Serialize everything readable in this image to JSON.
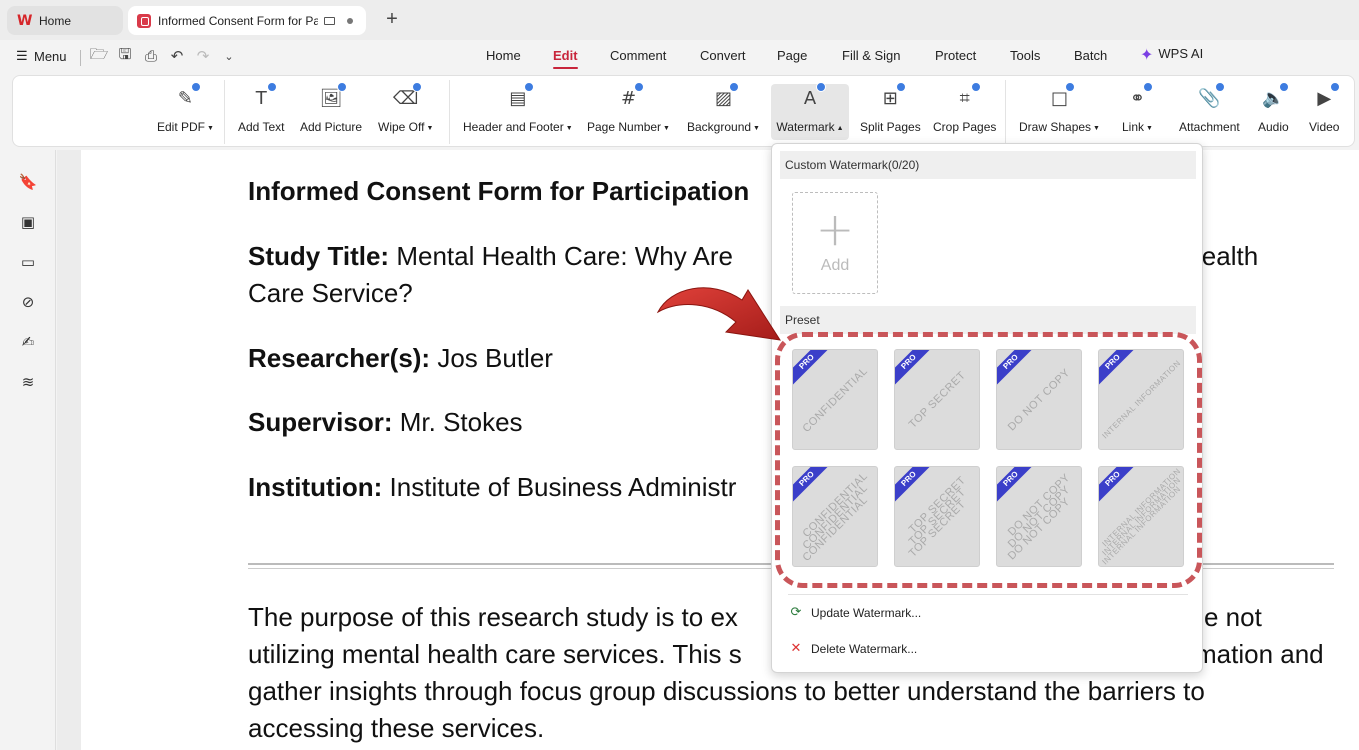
{
  "tabs": {
    "home": "Home",
    "document": "Informed Consent Form for Pa"
  },
  "menu": {
    "label": "Menu",
    "nav": [
      "Home",
      "Edit",
      "Comment",
      "Convert",
      "Page",
      "Fill & Sign",
      "Protect",
      "Tools",
      "Batch",
      "WPS AI"
    ],
    "active": "Edit"
  },
  "ribbon": {
    "edit_pdf": "Edit PDF",
    "add_text": "Add Text",
    "add_picture": "Add Picture",
    "wipe_off": "Wipe Off",
    "header_footer": "Header and Footer",
    "page_number": "Page Number",
    "background": "Background",
    "watermark": "Watermark",
    "split_pages": "Split Pages",
    "crop_pages": "Crop Pages",
    "draw_shapes": "Draw Shapes",
    "link": "Link",
    "attachment": "Attachment",
    "audio": "Audio",
    "video": "Video"
  },
  "document": {
    "title": "Informed Consent Form for Participation",
    "study_label": "Study Title:",
    "study_value_1": "Mental Health Care: Why Are",
    "study_value_tail": "Health",
    "study_value_2": "Care Service?",
    "researcher_label": "Researcher(s):",
    "researcher_value": "Jos Butler",
    "supervisor_label": "Supervisor:",
    "supervisor_value": "Mr. Stokes",
    "institution_label": "Institution:",
    "institution_value": "Institute of Business Administr",
    "para_line1_a": "The purpose of this research study is to ex",
    "para_line1_b": "e not",
    "para_line2_a": "utilizing mental health care services. This s",
    "para_line2_b": "mation and",
    "para_line3": "gather insights through focus group discussions to better understand the barriers to",
    "para_line4": "accessing these services."
  },
  "watermark_menu": {
    "custom_header": "Custom Watermark(0/20)",
    "add_label": "Add",
    "preset_header": "Preset",
    "pro_badge": "PRO",
    "presets": [
      {
        "text": "CONFIDENTIAL"
      },
      {
        "text": "TOP SECRET"
      },
      {
        "text": "DO NOT COPY"
      },
      {
        "text": "INTERNAL INFORMATION"
      },
      {
        "text": "CONFIDENTIAL"
      },
      {
        "text": "TOP SECRET"
      },
      {
        "text": "DO NOT COPY"
      },
      {
        "text": "INTERNAL INFORMATION"
      }
    ],
    "update": "Update Watermark...",
    "delete": "Delete Watermark..."
  },
  "colors": {
    "accent": "#c8253b",
    "annotation": "#c9565a",
    "pro_badge": "#3b3fc9"
  }
}
